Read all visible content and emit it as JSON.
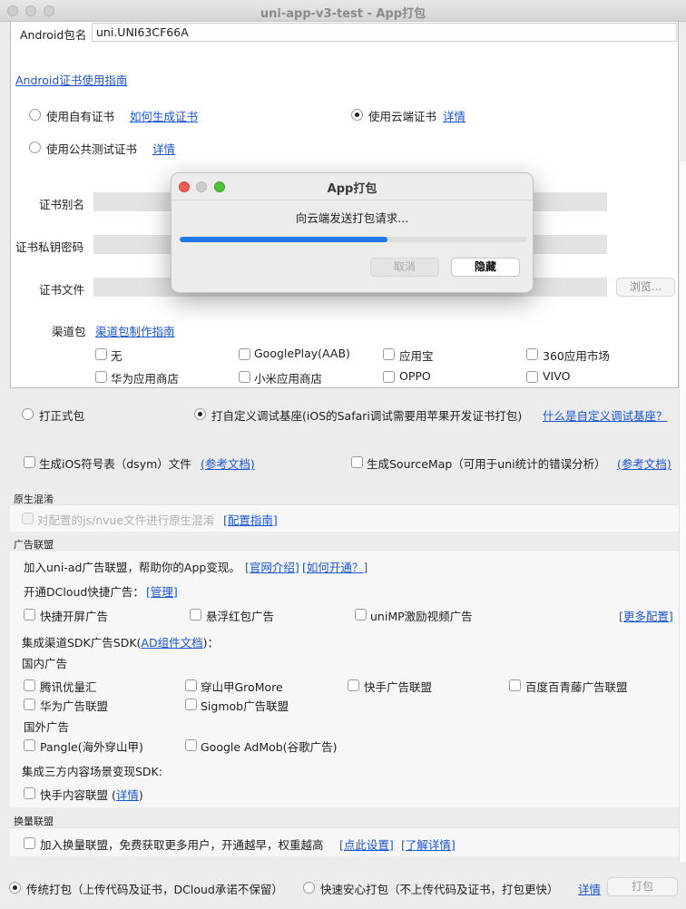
{
  "window": {
    "title": "uni-app-v3-test - App打包"
  },
  "package": {
    "label": "Android包名",
    "value": "uni.UNI63CF66A"
  },
  "cert": {
    "guide_link": "Android证书使用指南",
    "own_label": "使用自有证书",
    "own_link": "如何生成证书",
    "cloud_label": "使用云端证书",
    "cloud_link": "详情",
    "public_label": "使用公共测试证书",
    "public_link": "详情",
    "alias_label": "证书别名",
    "key_label": "证书私钥密码",
    "file_label": "证书文件",
    "browse_label": "浏览..."
  },
  "channel": {
    "label": "渠道包",
    "guide_link": "渠道包制作指南",
    "items": [
      "无",
      "GooglePlay(AAB)",
      "应用宝",
      "360应用市场",
      "华为应用商店",
      "小米应用商店",
      "OPPO",
      "VIVO"
    ]
  },
  "build_type": {
    "formal_label": "打正式包",
    "custom_label": "打自定义调试基座(iOS的Safari调试需要用苹果开发证书打包)",
    "custom_link": "什么是自定义调试基座？"
  },
  "symbols": {
    "dsym_label": "生成iOS符号表（dsym）文件",
    "dsym_link": "(参考文档)",
    "sourcemap_label": "生成SourceMap（可用于uni统计的错误分析）",
    "sourcemap_link": "(参考文档)"
  },
  "obfuscation": {
    "section": "原生混淆",
    "label": "对配置的js/nvue文件进行原生混淆",
    "link": "[配置指南]"
  },
  "ads": {
    "section": "广告联盟",
    "join_text": "加入uni-ad广告联盟，帮助你的App变现。",
    "intro_link": "[官网介绍]",
    "how_link": "[如何开通？]",
    "quick_text": "开通DCloud快捷广告：",
    "manage_link": "[管理]",
    "quick_items": [
      "快捷开屏广告",
      "悬浮红包广告",
      "uniMP激励视频广告"
    ],
    "more_link": "[更多配置]",
    "sdk_text_before": "集成渠道SDK广告SDK(",
    "sdk_link": "AD组件文档",
    "sdk_text_after": ")：",
    "domestic_label": "国内广告",
    "domestic_items": [
      "腾讯优量汇",
      "穿山甲GroMore",
      "快手广告联盟",
      "百度百青藤广告联盟",
      "华为广告联盟",
      "Sigmob广告联盟"
    ],
    "foreign_label": "国外广告",
    "foreign_items": [
      "Pangle(海外穿山甲)",
      "Google AdMob(谷歌广告)"
    ],
    "content_text": "集成三方内容场景变现SDK:",
    "content_item": "快手内容联盟 (",
    "content_link": "详情",
    "content_close": ")"
  },
  "exchange": {
    "section": "换量联盟",
    "label": "加入换量联盟，免费获取更多用户，开通越早，权重越高",
    "setup_link": "[点此设置]",
    "learn_link": "[了解详情]"
  },
  "bottom": {
    "traditional_label": "传统打包（上传代码及证书，DCloud承诺不保留）",
    "fast_label": "快速安心打包（不上传代码及证书，打包更快）",
    "detail_link": "详情",
    "pack_button": "打包"
  },
  "dialog": {
    "title": "App打包",
    "message": "向云端发送打包请求...",
    "progress": 0.6,
    "cancel_label": "取消",
    "hide_label": "隐藏"
  }
}
